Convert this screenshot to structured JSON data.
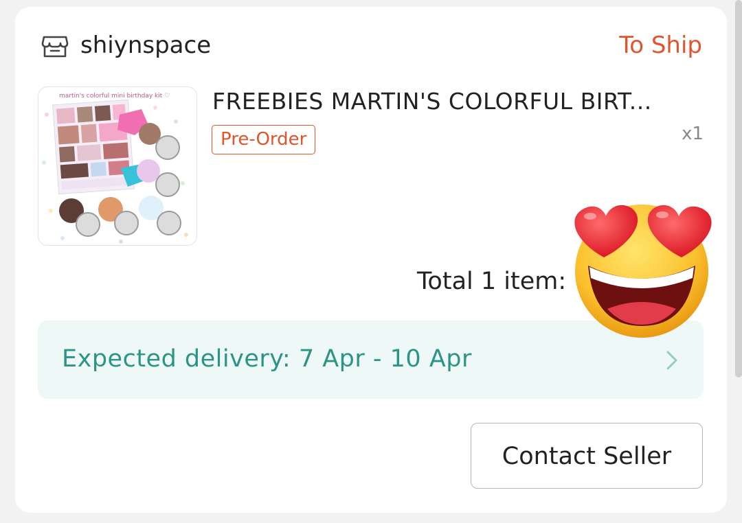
{
  "shop": {
    "name": "shiynspace",
    "status": "To Ship"
  },
  "product": {
    "title": "FREEBIES MARTIN'S COLORFUL BIRT...",
    "badge": "Pre-Order",
    "quantity": "x1",
    "thumbnail_caption": "martin's colorful mini birthday kit ♡"
  },
  "order": {
    "total": "Total 1 item:"
  },
  "delivery": {
    "label": "Expected delivery: 7 Apr - 10 Apr"
  },
  "actions": {
    "contact_seller": "Contact Seller"
  },
  "sticker": {
    "emoji_name": "smiling-face-with-heart-eyes"
  },
  "colors": {
    "accent": "#e0552e",
    "teal": "#2b9486",
    "delivery_bg": "#eef8f6"
  }
}
